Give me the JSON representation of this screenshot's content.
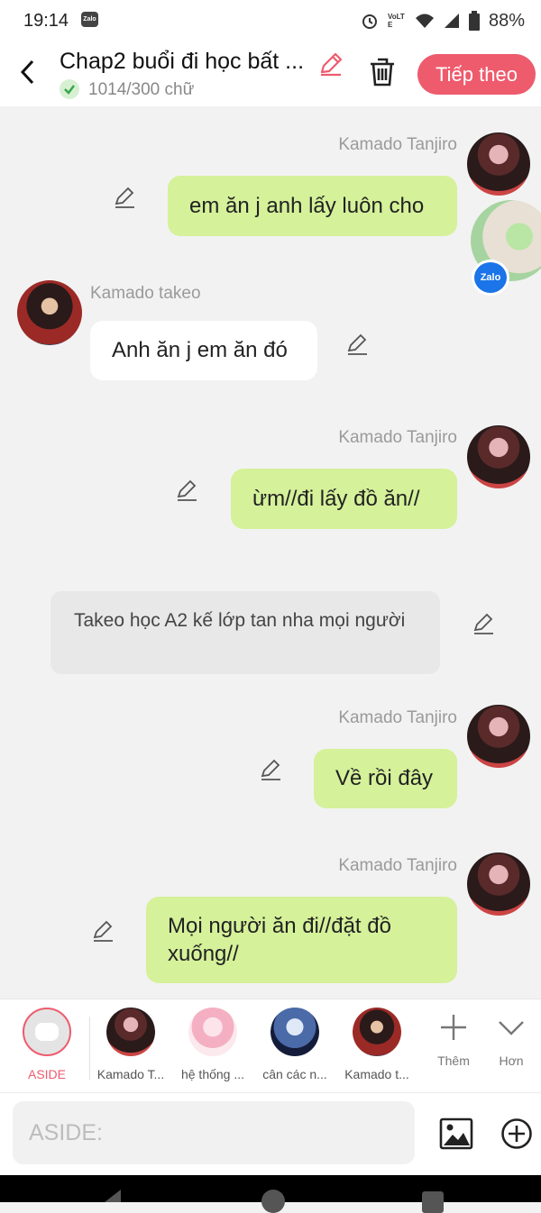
{
  "status": {
    "time": "19:14",
    "app_chip": "Zalo",
    "volte": "VoLTE",
    "battery": "88%"
  },
  "header": {
    "title": "Chap2 buổi đi học bất ...",
    "count": "1014/300 chữ",
    "next_label": "Tiếp theo"
  },
  "messages": [
    {
      "speaker": "Kamado Tanjiro",
      "text": "em ăn j anh lấy luôn cho"
    },
    {
      "speaker": "Kamado takeo",
      "text": "Anh ăn j em ăn đó"
    },
    {
      "speaker": "Kamado Tanjiro",
      "text": "ừm//đi lấy đồ ăn//"
    },
    {
      "narration": "Takeo học A2 kế lớp tan nha mọi người"
    },
    {
      "speaker": "Kamado Tanjiro",
      "text": "Về rồi đây"
    },
    {
      "speaker": "Kamado Tanjiro",
      "text": "Mọi người ăn đi//đặt đồ xuống//"
    }
  ],
  "floating_badge": "Zalo",
  "characters": [
    "ASIDE",
    "Kamado T...",
    "hệ thống ...",
    "cân các n...",
    "Kamado t..."
  ],
  "more": {
    "add_label": "Thêm",
    "more_label": "Hơn"
  },
  "input": {
    "placeholder": "ASIDE:"
  },
  "colors": {
    "accent": "#ee5b6d",
    "bubble_green": "#d5f19a",
    "badge_blue": "#1b74e8"
  }
}
